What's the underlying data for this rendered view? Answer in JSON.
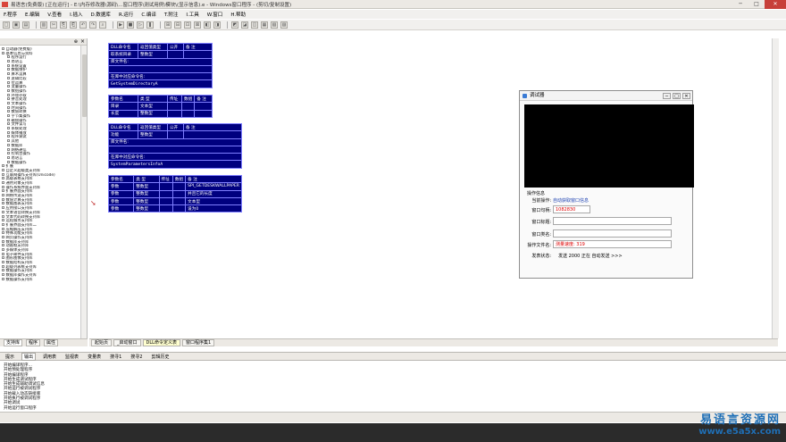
{
  "window": {
    "title": "易语言(免费版) [正在运行] - E:\\内存修改器\\源码\\...窗口程序\\测试用例\\模块\\(显示信息).e - Windows窗口程序 - (剪切/复制设置)",
    "min": "─",
    "max": "□",
    "close": "✕"
  },
  "menu": [
    "F.程序",
    "E.编辑",
    "V.查看",
    "I.插入",
    "D.数据库",
    "R.运行",
    "C.编译",
    "T.附注",
    "I.工具",
    "W.窗口",
    "H.帮助"
  ],
  "toolbar_icons": [
    "□",
    "▣",
    "▤",
    "▥",
    "✂",
    "⎘",
    "⎗",
    "↶",
    "↷",
    "⌕",
    "▶",
    "■",
    "▷",
    "❚",
    "⊞",
    "⊟",
    "⊡",
    "⊠",
    "◧",
    "◨",
    "◩",
    "◪",
    "◫",
    "▦",
    "▧",
    "▨"
  ],
  "left_panel": {
    "pin": "⊕",
    "close": "×",
    "items": [
      {
        "t": "自动器(免费版)",
        "sub": false
      },
      {
        "t": "基本信息与资料",
        "sub": false
      },
      {
        "t": "程序运行",
        "sub": true
      },
      {
        "t": "易语言",
        "sub": true
      },
      {
        "t": "系统设置",
        "sub": true
      },
      {
        "t": "数据维护",
        "sub": true
      },
      {
        "t": "算术运算",
        "sub": true
      },
      {
        "t": "逻辑比较",
        "sub": true
      },
      {
        "t": "位运算",
        "sub": true
      },
      {
        "t": "变量操作",
        "sub": true
      },
      {
        "t": "数组操作",
        "sub": true
      },
      {
        "t": "环境存取",
        "sub": true
      },
      {
        "t": "拼音处理",
        "sub": true
      },
      {
        "t": "文本操作",
        "sub": true
      },
      {
        "t": "时间操作",
        "sub": true
      },
      {
        "t": "数值转换",
        "sub": true
      },
      {
        "t": "字节集操作",
        "sub": true
      },
      {
        "t": "磁盘操作",
        "sub": true
      },
      {
        "t": "文件读写",
        "sub": true
      },
      {
        "t": "系统处理",
        "sub": true
      },
      {
        "t": "媒体播放",
        "sub": true
      },
      {
        "t": "程序调试",
        "sub": true
      },
      {
        "t": "其他",
        "sub": true
      },
      {
        "t": "数据库",
        "sub": true
      },
      {
        "t": "网络通信",
        "sub": true
      },
      {
        "t": "控制台操作",
        "sub": true
      },
      {
        "t": "易语言",
        "sub": true
      },
      {
        "t": "数据操作",
        "sub": true
      },
      {
        "t": "扩展",
        "sub": false
      },
      {
        "t": "自定义超级类支持库",
        "sub": false
      },
      {
        "t": "互联网操作支持库(Unicode)",
        "sub": false
      },
      {
        "t": "高级表格支持库",
        "sub": false
      },
      {
        "t": "通用对象支持库",
        "sub": false
      },
      {
        "t": "操作系统界面支持库",
        "sub": false
      },
      {
        "t": "扩展界面支持库",
        "sub": false
      },
      {
        "t": "网络传送支持库",
        "sub": false
      },
      {
        "t": "数值计算支持库",
        "sub": false
      },
      {
        "t": "数据图表支持库",
        "sub": false
      },
      {
        "t": "应用接口支持库",
        "sub": false
      },
      {
        "t": "文本语音转换支持库",
        "sub": false
      },
      {
        "t": "文本代码转换支持库",
        "sub": false
      },
      {
        "t": "远程服务支持库",
        "sub": false
      },
      {
        "t": "扩展界面支持库二",
        "sub": false
      },
      {
        "t": "压缩解压支持库",
        "sub": false
      },
      {
        "t": "特殊功能支持库",
        "sub": false
      },
      {
        "t": "网页操作支持库",
        "sub": false
      },
      {
        "t": "数据库支持库",
        "sub": false
      },
      {
        "t": "动画框支持库",
        "sub": false
      },
      {
        "t": "多媒体支持库",
        "sub": false
      },
      {
        "t": "电子邮件支持库",
        "sub": false
      },
      {
        "t": "图形图像支持库",
        "sub": false
      },
      {
        "t": "数据结构支持库",
        "sub": false
      },
      {
        "t": "超级列表框支持库",
        "sub": false
      },
      {
        "t": "数据操作支持库",
        "sub": false
      },
      {
        "t": "数据库操作支持库",
        "sub": false
      },
      {
        "t": "数据操作支持库",
        "sub": false
      }
    ]
  },
  "left_tabs": [
    "支持库",
    "程序",
    "属性"
  ],
  "editor_tabs": [
    {
      "label": "起始页",
      "active": false
    },
    {
      "label": "_启动窗口",
      "active": false
    },
    {
      "label": "DLL命令定义表",
      "active": true
    },
    {
      "label": "窗口程序集1",
      "active": false
    }
  ],
  "dll_table_1": {
    "header": [
      "DLL命令名",
      "返回值类型",
      "公开",
      "备 注"
    ],
    "row1": [
      "取系统目录",
      "整数型",
      "",
      ""
    ],
    "libfile_label": "库文件名:",
    "entry_label": "在库中对应命令名:",
    "entry_value": "GetSystemDirectoryA",
    "param_header": [
      "参数名",
      "类 型",
      "传址",
      "数组",
      "备 注"
    ],
    "params": [
      [
        "目录",
        "文本型",
        "",
        "",
        ""
      ],
      [
        "长度",
        "整数型",
        "",
        "",
        ""
      ]
    ]
  },
  "dll_table_2": {
    "header": [
      "DLL命令名",
      "返回值类型",
      "公开",
      "备 注"
    ],
    "row1": [
      "功能",
      "整数型",
      "",
      ""
    ],
    "libfile_label": "库文件名:",
    "entry_label": "在库中对应命令名:",
    "entry_value": "SystemParametersInfoA",
    "param_header": [
      "参数名",
      "类 型",
      "传址",
      "数组",
      "备 注"
    ],
    "params": [
      [
        "参数",
        "整数型",
        "",
        "",
        "SPI_GETDESKWALLPAPER"
      ],
      [
        "参数",
        "整数型",
        "",
        "",
        "并且它的长度"
      ],
      [
        "参数",
        "整数型",
        "",
        "",
        "文本型"
      ],
      [
        "参数",
        "整数型",
        "",
        "",
        "设为0"
      ]
    ]
  },
  "bottom_tabs": [
    {
      "label": "提示",
      "active": false
    },
    {
      "label": "输出",
      "active": true
    },
    {
      "label": "调用表",
      "active": false
    },
    {
      "label": "监视表",
      "active": false
    },
    {
      "label": "变量表",
      "active": false
    },
    {
      "label": "搜寻1",
      "active": false
    },
    {
      "label": "搜寻2",
      "active": false
    },
    {
      "label": "剪辑历史",
      "active": false
    }
  ],
  "output_lines": [
    "开始编译程序...",
    "开始预处理程序",
    "开始编译程序",
    "开始生成调试程序",
    "开始生成辅助调试信息",
    "开始运行被调试程序",
    "开始载入动态链接库",
    "开始执行被调试程序",
    "开始调试",
    "开始运行窗口程序"
  ],
  "float_window": {
    "title": "调试器",
    "btns": [
      "─",
      "□",
      "✕"
    ],
    "section": "操作信息",
    "row_current_label": "当前操作:",
    "row_current_value": "自动获取窗口信息",
    "row_handle_label": "窗口句柄:",
    "row_handle_value": "1082830",
    "row_title_label": "窗口标题:",
    "row_title_value": "",
    "row_class_label": "窗口类名:",
    "row_class_value": "",
    "row_file_label": "操作文件名:",
    "row_file_value": "测量速度: 319",
    "row_status_label": "发表状态:",
    "row_status_value": "发送 2000 正在 自动发送 >>>"
  },
  "watermark": {
    "line1": "易语言资源网",
    "line2": "www.e5a5x.com"
  }
}
